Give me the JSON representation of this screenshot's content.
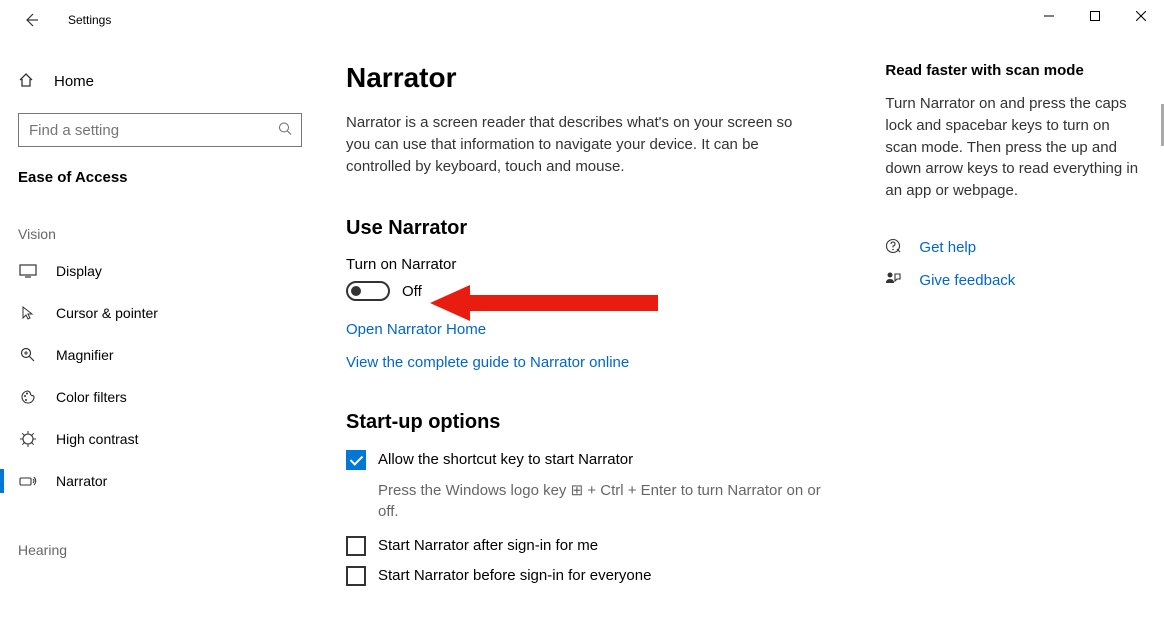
{
  "window": {
    "title": "Settings"
  },
  "sidebar": {
    "home": "Home",
    "search_placeholder": "Find a setting",
    "section": "Ease of Access",
    "group_vision": "Vision",
    "group_hearing": "Hearing",
    "items": [
      {
        "label": "Display"
      },
      {
        "label": "Cursor & pointer"
      },
      {
        "label": "Magnifier"
      },
      {
        "label": "Color filters"
      },
      {
        "label": "High contrast"
      },
      {
        "label": "Narrator"
      }
    ]
  },
  "page": {
    "title": "Narrator",
    "description": "Narrator is a screen reader that describes what's on your screen so you can use that information to navigate your device. It can be controlled by keyboard, touch and mouse.",
    "use_heading": "Use Narrator",
    "turn_on_label": "Turn on Narrator",
    "toggle_state": "Off",
    "link_open_home": "Open Narrator Home",
    "link_guide": "View the complete guide to Narrator online",
    "startup_heading": "Start-up options",
    "chk_shortcut": "Allow the shortcut key to start Narrator",
    "chk_shortcut_hint": "Press the Windows logo key ⊞ + Ctrl + Enter to turn Narrator on or off.",
    "chk_after": "Start Narrator after sign-in for me",
    "chk_before": "Start Narrator before sign-in for everyone"
  },
  "aside": {
    "scan_title": "Read faster with scan mode",
    "scan_text": "Turn Narrator on and press the caps lock and spacebar keys to turn on scan mode. Then press the up and down arrow keys to read everything in an app or webpage.",
    "get_help": "Get help",
    "give_feedback": "Give feedback"
  }
}
